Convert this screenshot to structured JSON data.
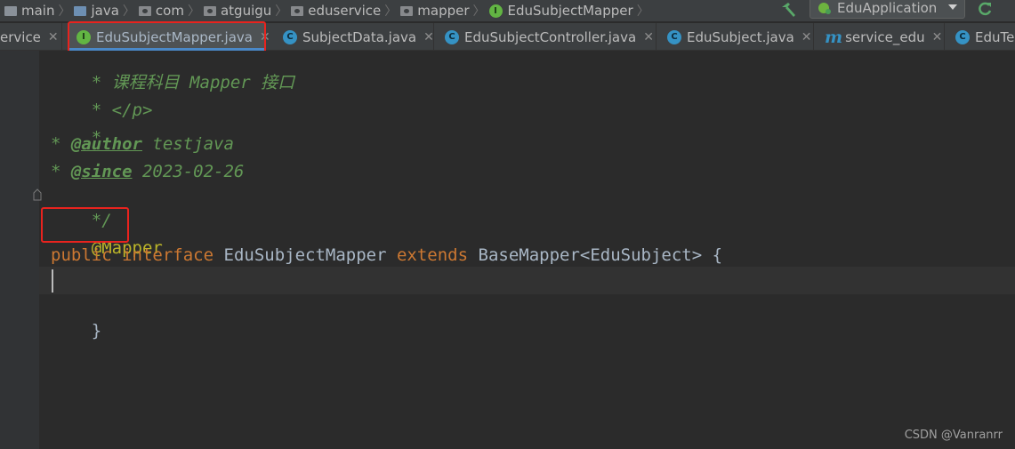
{
  "breadcrumb": [
    {
      "label": "main",
      "icon": "folder-icon"
    },
    {
      "label": "java",
      "icon": "source-folder-icon"
    },
    {
      "label": "com",
      "icon": "package-icon"
    },
    {
      "label": "atguigu",
      "icon": "package-icon"
    },
    {
      "label": "eduservice",
      "icon": "package-icon"
    },
    {
      "label": "mapper",
      "icon": "package-icon"
    },
    {
      "label": "EduSubjectMapper",
      "icon": "interface-icon"
    }
  ],
  "run_config": {
    "label": "EduApplication",
    "icon": "spring-boot-icon"
  },
  "tabs": [
    {
      "label": "ervice",
      "icon": "none",
      "active": false
    },
    {
      "label": "EduSubjectMapper.java",
      "icon": "I",
      "active": true
    },
    {
      "label": "SubjectData.java",
      "icon": "C",
      "active": false
    },
    {
      "label": "EduSubjectController.java",
      "icon": "C",
      "active": false
    },
    {
      "label": "EduSubject.java",
      "icon": "C",
      "active": false
    },
    {
      "label": "service_edu",
      "icon": "m",
      "active": false
    },
    {
      "label": "EduTe",
      "icon": "C",
      "active": false
    }
  ],
  "code": {
    "l1": "* 课程科目 Mapper 接口",
    "l2": "* </p>",
    "l3": "*",
    "l4_star": "* ",
    "l4_tag": "@author",
    "l4_val": " testjava",
    "l5_star": "* ",
    "l5_tag": "@since",
    "l5_val": " 2023-02-26",
    "l6": "*/",
    "l7": "@Mapper",
    "l8_kw1": "public",
    "l8_kw2": "interface",
    "l8_name": "EduSubjectMapper",
    "l8_kw3": "extends",
    "l8_type": "BaseMapper<EduSubject>",
    "l8_brace": "{",
    "l10": "}"
  },
  "watermark": "CSDN @Vanranrr",
  "colors": {
    "highlight_box": "#e8231e",
    "accent": "#4a88c7"
  }
}
